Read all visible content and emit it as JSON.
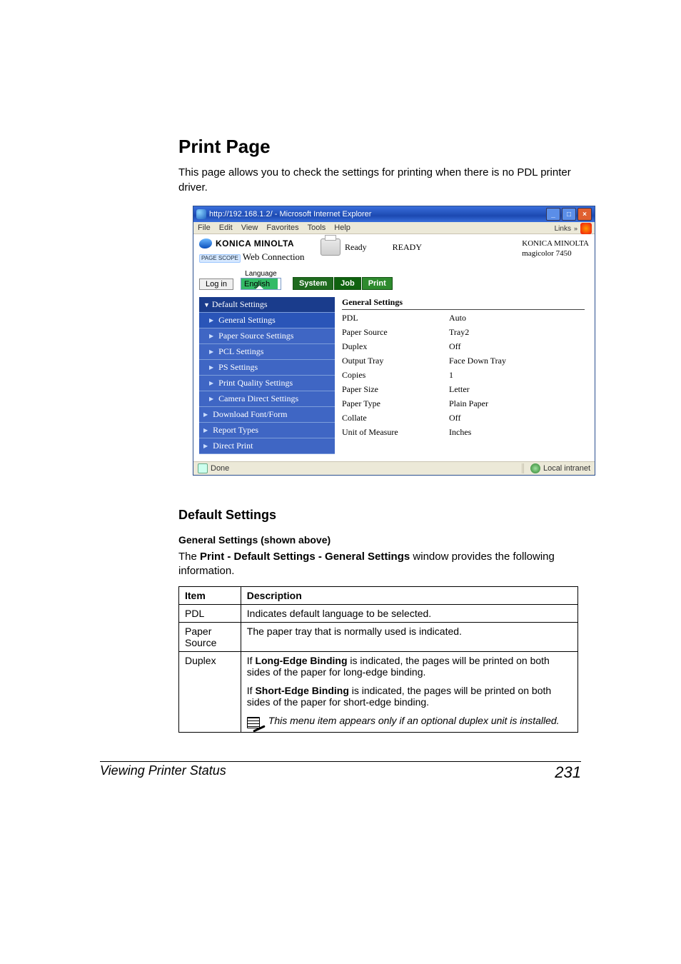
{
  "page": {
    "heading": "Print Page",
    "intro": "This page allows you to check the settings for printing when there is no PDL printer driver."
  },
  "browser": {
    "titlebar": "http://192.168.1.2/ - Microsoft Internet Explorer",
    "menus": {
      "file": "File",
      "edit": "Edit",
      "view": "View",
      "favorites": "Favorites",
      "tools": "Tools",
      "help": "Help",
      "links": "Links"
    },
    "status_done": "Done",
    "status_zone": "Local intranet"
  },
  "header": {
    "brand": "KONICA MINOLTA",
    "pagescope": "PAGE SCOPE",
    "webconn": "Web Connection",
    "ready_small": "Ready",
    "ready_big": "READY",
    "model_line1": "KONICA MINOLTA",
    "model_line2": "magicolor 7450"
  },
  "controls": {
    "login": "Log in",
    "language_label": "Language",
    "language_value": "English",
    "tabs": {
      "system": "System",
      "job": "Job",
      "print": "Print"
    }
  },
  "nav": {
    "header": "Default Settings",
    "items": {
      "general": "General Settings",
      "paper_source": "Paper Source Settings",
      "pcl": "PCL Settings",
      "ps": "PS Settings",
      "print_quality": "Print Quality Settings",
      "camera": "Camera Direct Settings",
      "download": "Download Font/Form",
      "report": "Report Types",
      "direct": "Direct Print"
    }
  },
  "settings": {
    "title": "General Settings",
    "rows": {
      "pdl_k": "PDL",
      "pdl_v": "Auto",
      "paper_source_k": "Paper Source",
      "paper_source_v": "Tray2",
      "duplex_k": "Duplex",
      "duplex_v": "Off",
      "output_tray_k": "Output Tray",
      "output_tray_v": "Face Down Tray",
      "copies_k": "Copies",
      "copies_v": "1",
      "paper_size_k": "Paper Size",
      "paper_size_v": "Letter",
      "paper_type_k": "Paper Type",
      "paper_type_v": "Plain Paper",
      "collate_k": "Collate",
      "collate_v": "Off",
      "unit_k": "Unit of Measure",
      "unit_v": "Inches"
    }
  },
  "section": {
    "heading": "Default Settings",
    "sub": "General Settings (shown above)",
    "body_pre": "The ",
    "body_bold": "Print - Default Settings - General Settings",
    "body_post": " window provides the following information."
  },
  "table": {
    "head_item": "Item",
    "head_desc": "Description",
    "pdl_item": "PDL",
    "pdl_desc": "Indicates default language to be selected.",
    "ps_item": "Paper Source",
    "ps_desc": "The paper tray that is normally used is indicated.",
    "dup_item": "Duplex",
    "dup_p1a": "If ",
    "dup_p1b": "Long-Edge Binding",
    "dup_p1c": " is indicated, the pages will be printed on both sides of the paper for long-edge binding.",
    "dup_p2a": "If ",
    "dup_p2b": "Short-Edge Binding",
    "dup_p2c": " is indicated, the pages will be printed on both sides of the paper for short-edge binding.",
    "dup_note": "This menu item appears only if an optional duplex unit is installed."
  },
  "footer": {
    "left": "Viewing Printer Status",
    "right": "231"
  }
}
